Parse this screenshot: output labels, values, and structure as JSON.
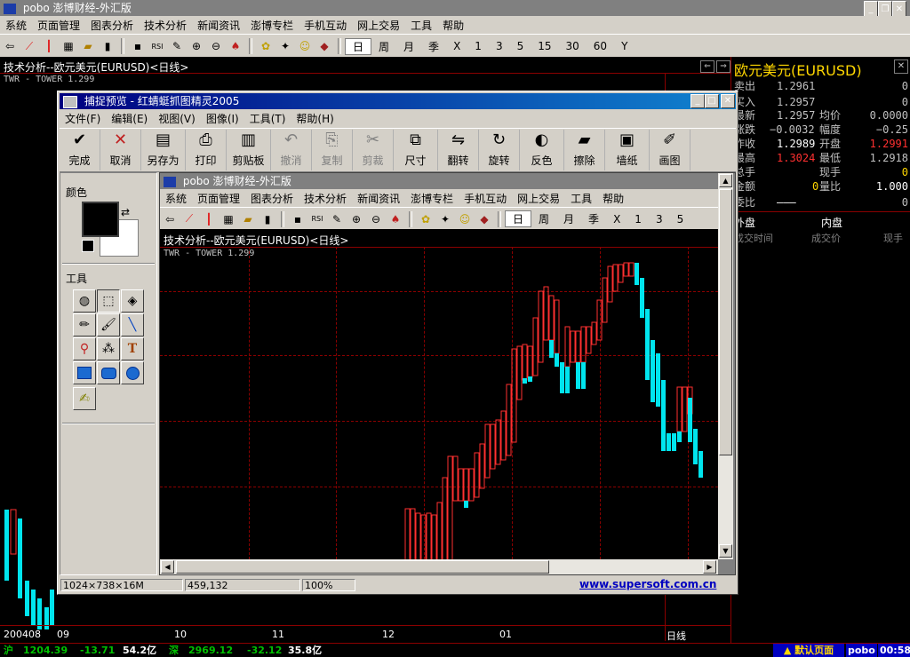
{
  "main": {
    "title": "pobo 澎博财经-外汇版",
    "menu": [
      "系统",
      "页面管理",
      "图表分析",
      "技术分析",
      "新闻资讯",
      "澎博专栏",
      "手机互动",
      "网上交易",
      "工具",
      "帮助"
    ],
    "periods": [
      "日",
      "周",
      "月",
      "季",
      "X",
      "1",
      "3",
      "5",
      "15",
      "30",
      "60",
      "Y"
    ],
    "chart_title": "技术分析--欧元美元(EURUSD)<日线>",
    "indicator": "TWR - TOWER 1.299",
    "x_ticks": [
      "200408",
      "09",
      "10",
      "11",
      "12",
      "01"
    ],
    "period_label": "日线"
  },
  "quote": {
    "title": "欧元美元(EURUSD)",
    "rows": [
      {
        "label": "卖出",
        "value": "1.2961",
        "label2": "",
        "value2": "0"
      },
      {
        "label": "买入",
        "value": "1.2957",
        "label2": "",
        "value2": "0"
      },
      {
        "label": "最新",
        "value": "1.2957",
        "label2": "均价",
        "value2": "0.0000"
      },
      {
        "label": "涨跌",
        "value": "−0.0032",
        "label2": "幅度",
        "value2": "−0.25"
      },
      {
        "label": "昨收",
        "value": "1.2989",
        "label2": "开盘",
        "value2": "1.2991"
      },
      {
        "label": "最高",
        "value": "1.3024",
        "label2": "最低",
        "value2": "1.2918"
      },
      {
        "label": "总手",
        "value": "",
        "label2": "现手",
        "value2": "0"
      },
      {
        "label": "金额",
        "value": "0",
        "label2": "量比",
        "value2": "1.000"
      },
      {
        "label": "委比",
        "value": "———",
        "label2": "",
        "value2": "0"
      }
    ],
    "outer": "外盘",
    "inner": "内盘",
    "time_header": "成交时间",
    "price_header": "成交价",
    "vol_header": "现手"
  },
  "capture": {
    "title": "捕捉预览 - 红蜻蜓抓图精灵2005",
    "menu": [
      "文件(F)",
      "编辑(E)",
      "视图(V)",
      "图像(I)",
      "工具(T)",
      "帮助(H)"
    ],
    "buttons": [
      "完成",
      "取消",
      "另存为",
      "打印",
      "剪贴板",
      "撤消",
      "复制",
      "剪裁",
      "尺寸",
      "翻转",
      "旋转",
      "反色",
      "擦除",
      "墙纸",
      "画图"
    ],
    "color_label": "颜色",
    "tools_label": "工具",
    "status_size": "1024×738×16M",
    "status_pos": "459,132",
    "status_zoom": "100%",
    "website": "www.supersoft.com.cn"
  },
  "inner": {
    "menu": [
      "系统",
      "页面管理",
      "图表分析",
      "技术分析",
      "新闻资讯",
      "澎博专栏",
      "手机互动",
      "网上交易",
      "工具",
      "帮助"
    ],
    "periods": [
      "日",
      "周",
      "月",
      "季",
      "X",
      "1",
      "3",
      "5"
    ],
    "chart_title": "技术分析--欧元美元(EURUSD)<日线>",
    "indicator": "TWR - TOWER 1.299"
  },
  "ticker": {
    "sh_label": "沪",
    "sh_value": "1204.39",
    "sh_change": "-13.71",
    "sh_amount": "54.2亿",
    "sz_label": "深",
    "sz_value": "2969.12",
    "sz_change": "-32.12",
    "sz_amount": "35.8亿",
    "default_page": "默认页面",
    "brand": "pobo",
    "time": "00:58"
  },
  "colors": {
    "up": "#ff3030",
    "down": "#00e5ee",
    "grid": "#8b0000",
    "window": "#d4d0c8",
    "title_blue": "#000080"
  }
}
